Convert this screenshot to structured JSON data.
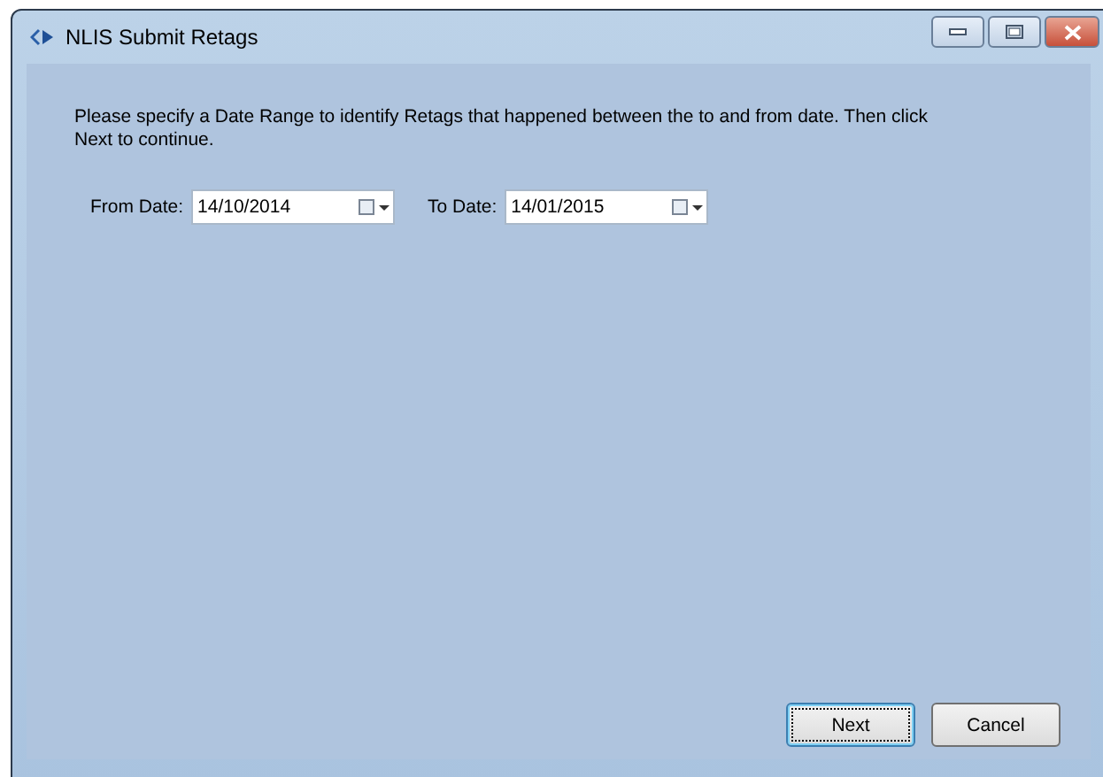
{
  "window": {
    "title": "NLIS Submit Retags"
  },
  "instructions": "Please specify a Date Range to identify Retags that happened between the to and from date. Then click Next to continue.",
  "dates": [
    {
      "label": "From Date:",
      "value": "14/10/2014"
    },
    {
      "label": "To Date:",
      "value": "14/01/2015"
    }
  ],
  "buttons": [
    {
      "label": "Next",
      "selected": true
    },
    {
      "label": "Cancel",
      "selected": false
    }
  ]
}
